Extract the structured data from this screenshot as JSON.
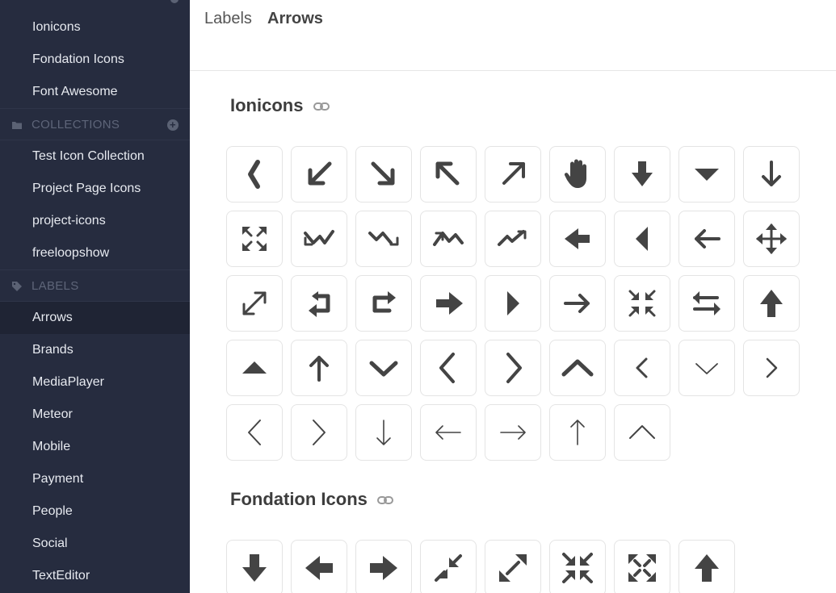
{
  "sidebar": {
    "items_top": [
      "Ionicons",
      "Fondation Icons",
      "Font Awesome"
    ],
    "collections_header": "COLLECTIONS",
    "collections": [
      "Test Icon Collection",
      "Project Page Icons",
      "project-icons",
      "freeloopshow"
    ],
    "labels_header": "LABELS",
    "labels": [
      "Arrows",
      "Brands",
      "MediaPlayer",
      "Meteor",
      "Mobile",
      "Payment",
      "People",
      "Social",
      "TextEditor"
    ],
    "active_label": "Arrows"
  },
  "breadcrumb": {
    "root": "Labels",
    "current": "Arrows"
  },
  "sets": [
    {
      "title": "Ionicons",
      "icons": [
        "chevron-left-bold-icon",
        "arrow-down-left-icon",
        "arrow-down-right-icon",
        "arrow-up-left-icon",
        "arrow-up-right-icon",
        "hand-icon",
        "arrow-down-solid-icon",
        "caret-down-icon",
        "arrow-down-icon",
        "expand-icon",
        "trend-down-icon",
        "trend-down-right-icon",
        "trend-up-down-icon",
        "trend-up-icon",
        "arrow-left-solid-icon",
        "caret-left-icon",
        "arrow-left-icon",
        "move-icon",
        "resize-icon",
        "return-left-icon",
        "return-right-icon",
        "arrow-right-solid-icon",
        "caret-right-icon",
        "arrow-right-icon",
        "contract-icon",
        "swap-icon",
        "arrow-up-solid-icon",
        "caret-up-icon",
        "arrow-up-icon",
        "chevron-down-bold-icon",
        "chevron-left-medium-icon",
        "chevron-right-medium-icon",
        "chevron-up-bold-icon",
        "chevron-left-thin-icon",
        "chevron-down-thin-icon",
        "chevron-right-thin-icon",
        "angle-left-icon",
        "angle-right-icon",
        "arrow-down-thin-icon",
        "arrow-left-thin-icon",
        "arrow-right-thin-icon",
        "arrow-up-thin-icon",
        "angle-up-icon"
      ]
    },
    {
      "title": "Fondation Icons",
      "icons": [
        "arrow-down-fat-icon",
        "arrow-left-fat-icon",
        "arrow-right-fat-icon",
        "arrows-compress-icon",
        "arrows-expand-icon",
        "arrows-in-icon",
        "arrows-out-icon",
        "arrow-up-fat-icon"
      ]
    }
  ],
  "colors": {
    "sidebar_bg": "#262c3f",
    "icon": "#444444",
    "accent_muted": "#5e6579"
  }
}
